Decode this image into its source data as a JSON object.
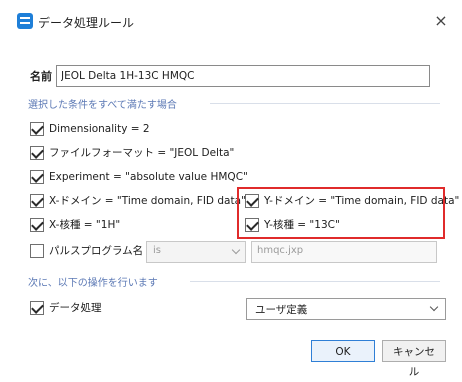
{
  "window": {
    "title": "データ処理ルール",
    "icon": "app-icon",
    "close_label": "×"
  },
  "name_field": {
    "label": "名前",
    "value": "JEOL Delta 1H-13C HMQC"
  },
  "conditions": {
    "section_label": "選択した条件をすべて満たす場合",
    "items": [
      {
        "label": "Dimensionality = 2",
        "checked": true
      },
      {
        "label": "ファイルフォーマット = \"JEOL Delta\"",
        "checked": true
      },
      {
        "label": "Experiment = \"absolute value HMQC\"",
        "checked": true
      },
      {
        "label": "X-ドメイン = \"Time domain, FID data\"",
        "checked": true
      },
      {
        "label": "Y-ドメイン = \"Time domain, FID data\"",
        "checked": true
      },
      {
        "label": "X-核種 = \"1H\"",
        "checked": true
      },
      {
        "label": "Y-核種 = \"13C\"",
        "checked": true
      },
      {
        "label": "パルスプログラム名",
        "checked": false
      }
    ],
    "pulse_operator": "is",
    "pulse_value": "hmqc.jxp"
  },
  "actions": {
    "section_label": "次に、以下の操作を行います",
    "item": {
      "label": "データ処理",
      "checked": true
    },
    "select_value": "ユーザ定義"
  },
  "buttons": {
    "ok": "OK",
    "cancel": "キャンセル"
  },
  "colors": {
    "accent": "#1e7fd8",
    "section_text": "#5c79b5",
    "highlight": "#e02b2b"
  }
}
